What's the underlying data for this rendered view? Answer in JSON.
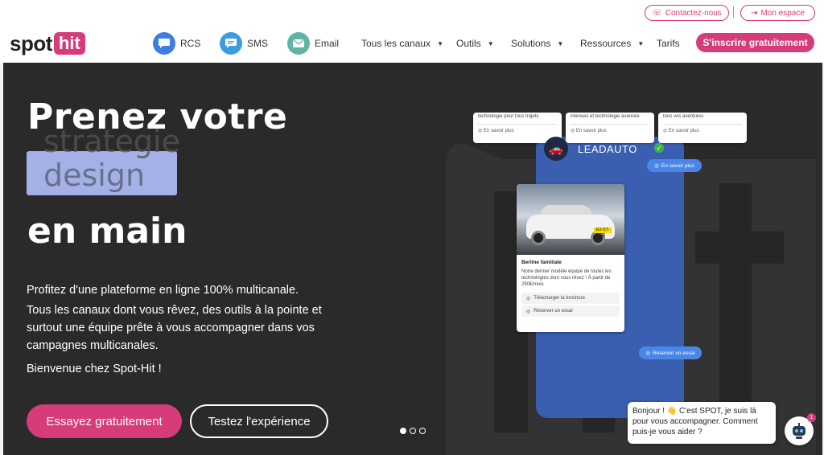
{
  "topbar": {
    "contact_label": "Contactez-nous",
    "account_label": "Mon espace"
  },
  "nav": {
    "logo_part1": "spot",
    "logo_part2": "hit",
    "items": [
      {
        "label": "RCS",
        "icon": "rcs-chat-icon"
      },
      {
        "label": "SMS",
        "icon": "sms-chat-icon"
      },
      {
        "label": "Email",
        "icon": "email-icon"
      },
      {
        "label": "Tous les canaux"
      },
      {
        "label": "Outils"
      },
      {
        "label": "Solutions"
      },
      {
        "label": "Ressources"
      },
      {
        "label": "Tarifs"
      }
    ],
    "cta_label": "S'inscrire gratuitement"
  },
  "hero": {
    "headline_line1": "Prenez votre",
    "rotating_words": [
      "strategie",
      "design"
    ],
    "headline_line3": "en main",
    "paragraph1": "Profitez d'une plateforme en ligne 100% multicanale.",
    "paragraph2": "Tous les canaux dont vous rêvez, des outils à la pointe et surtout une équipe prête à vous accompagner dans vos campagnes multicanales.",
    "paragraph3": "Bienvenue chez Spot-Hit !",
    "primary_button": "Essayez gratuitement",
    "secondary_button": "Testez l'expérience",
    "slide_count": 3,
    "active_slide": 1
  },
  "mockup": {
    "cards_top": [
      {
        "text": "technologie pour tous trajets",
        "button": "En savoir plus"
      },
      {
        "text": "intenses et technologie avancée",
        "button": "En savoir plus"
      },
      {
        "text": "tous vos aventures",
        "button": "En savoir plus"
      }
    ],
    "sender_name": "LEADAUTO",
    "chip_more": "En savoir plus",
    "car_card": {
      "plate": "EX-ST-CE",
      "title": "Berline familiale",
      "description": "Notre dernier modèle équipé de toutes les technologies dont vous rêvez ! À partir de 290€/mois",
      "button1": "Télécharger la brochure",
      "button2": "Réserver un essai"
    },
    "chip_reserve": "Réserver un essai"
  },
  "chatbot": {
    "message": "Bonjour ! 👋 C'est SPOT, je suis là pour vous accompagner. Comment puis-je vous aider ?",
    "badge_count": "1"
  },
  "colors": {
    "brand_pink": "#d63b7a",
    "hero_bg": "#2a2a2a",
    "phone_blue": "#3a5fb0",
    "highlight_box": "#a4b1e6"
  }
}
